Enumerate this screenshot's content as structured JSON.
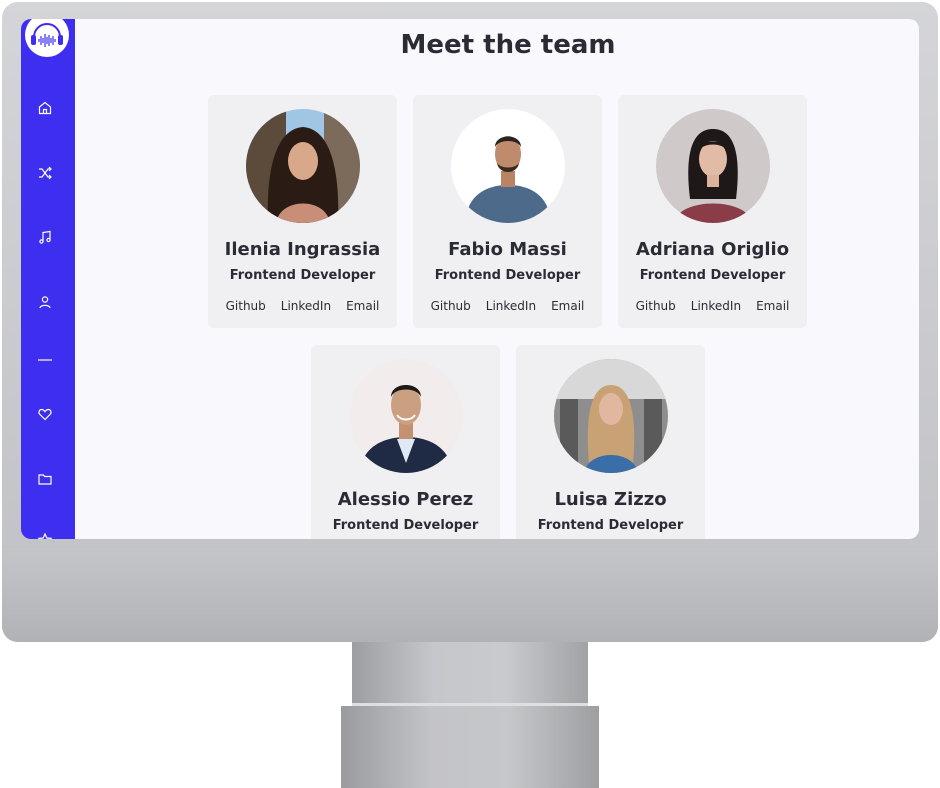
{
  "page": {
    "title": "Meet the team"
  },
  "sidebar": {
    "logo_icon": "headphones-soundwave-icon",
    "accent_color": "#3d2ef0",
    "items": [
      {
        "icon": "home-icon"
      },
      {
        "icon": "shuffle-icon"
      },
      {
        "icon": "music-note-icon"
      },
      {
        "icon": "user-icon"
      },
      {
        "icon": "divider-line"
      },
      {
        "icon": "heart-icon"
      },
      {
        "icon": "folder-icon"
      },
      {
        "icon": "star-icon"
      }
    ]
  },
  "team": [
    {
      "name": "Ilenia Ingrassia",
      "role": "Frontend Developer",
      "links": [
        "Github",
        "LinkedIn",
        "Email"
      ],
      "photo_icon": "profile-photo"
    },
    {
      "name": "Fabio Massi",
      "role": "Frontend Developer",
      "links": [
        "Github",
        "LinkedIn",
        "Email"
      ],
      "photo_icon": "profile-photo"
    },
    {
      "name": "Adriana Origlio",
      "role": "Frontend Developer",
      "links": [
        "Github",
        "LinkedIn",
        "Email"
      ],
      "photo_icon": "profile-photo"
    },
    {
      "name": "Alessio Perez",
      "role": "Frontend Developer",
      "photo_icon": "profile-photo"
    },
    {
      "name": "Luisa Zizzo",
      "role": "Frontend Developer",
      "photo_icon": "profile-photo"
    }
  ]
}
